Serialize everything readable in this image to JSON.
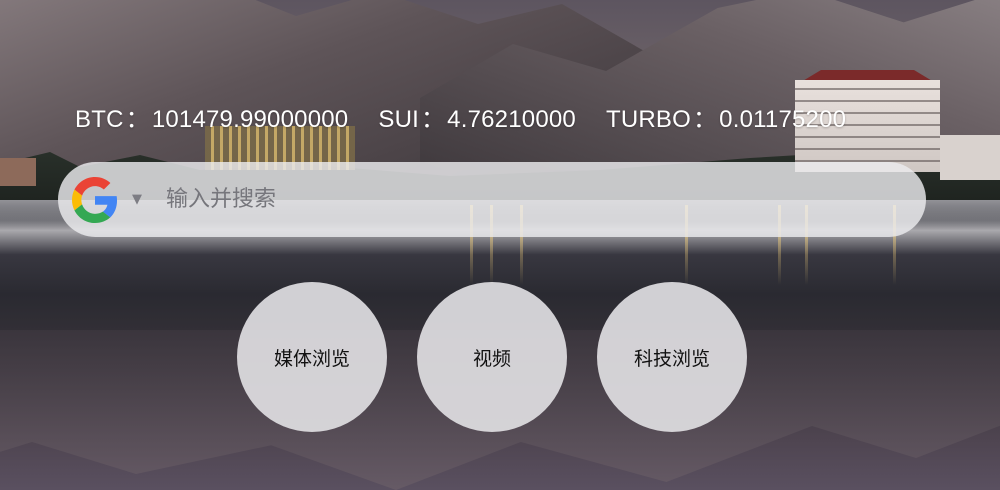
{
  "ticker": {
    "separator": "：",
    "items": [
      {
        "symbol": "BTC",
        "price": "101479.99000000"
      },
      {
        "symbol": "SUI",
        "price": "4.76210000"
      },
      {
        "symbol": "TURBO",
        "price": "0.01175200"
      }
    ]
  },
  "search": {
    "engine_icon": "google-g-icon",
    "dropdown_icon": "caret-down-icon",
    "caret_glyph": "▼",
    "placeholder": "输入并搜索",
    "value": ""
  },
  "quick_links": [
    {
      "label": "媒体浏览"
    },
    {
      "label": "视频"
    },
    {
      "label": "科技浏览"
    }
  ],
  "colors": {
    "text_light": "#ffffff",
    "search_bg": "#ebebee",
    "bubble_bg": "#dfdee2",
    "google_blue": "#4285F4",
    "google_red": "#EA4335",
    "google_yellow": "#FBBC05",
    "google_green": "#34A853"
  }
}
